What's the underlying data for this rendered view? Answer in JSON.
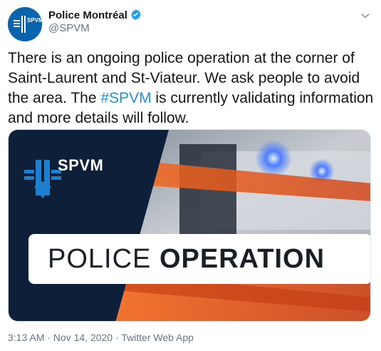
{
  "author": {
    "name": "Police Montréal",
    "handle": "@SPVM",
    "avatar_icon": "spvm-logo-icon",
    "verified_icon": "verified-badge-icon"
  },
  "tweet": {
    "text_before": "There is an ongoing police operation at the corner of Saint-Laurent and St-Viateur. We ask people to avoid the area. The ",
    "hashtag": "#SPVM",
    "text_after": " is currently validating information and more details will follow."
  },
  "media": {
    "brand": "SPVM",
    "banner_light": "POLICE ",
    "banner_bold": "OPERATION"
  },
  "meta": {
    "timestamp": "3:13 AM · Nov 14, 2020 · Twitter Web App"
  },
  "colors": {
    "link": "#1b95e0",
    "navy": "#0e1f3a",
    "brand_blue": "#1e7fcf",
    "tape_orange": "#f05a1a"
  }
}
